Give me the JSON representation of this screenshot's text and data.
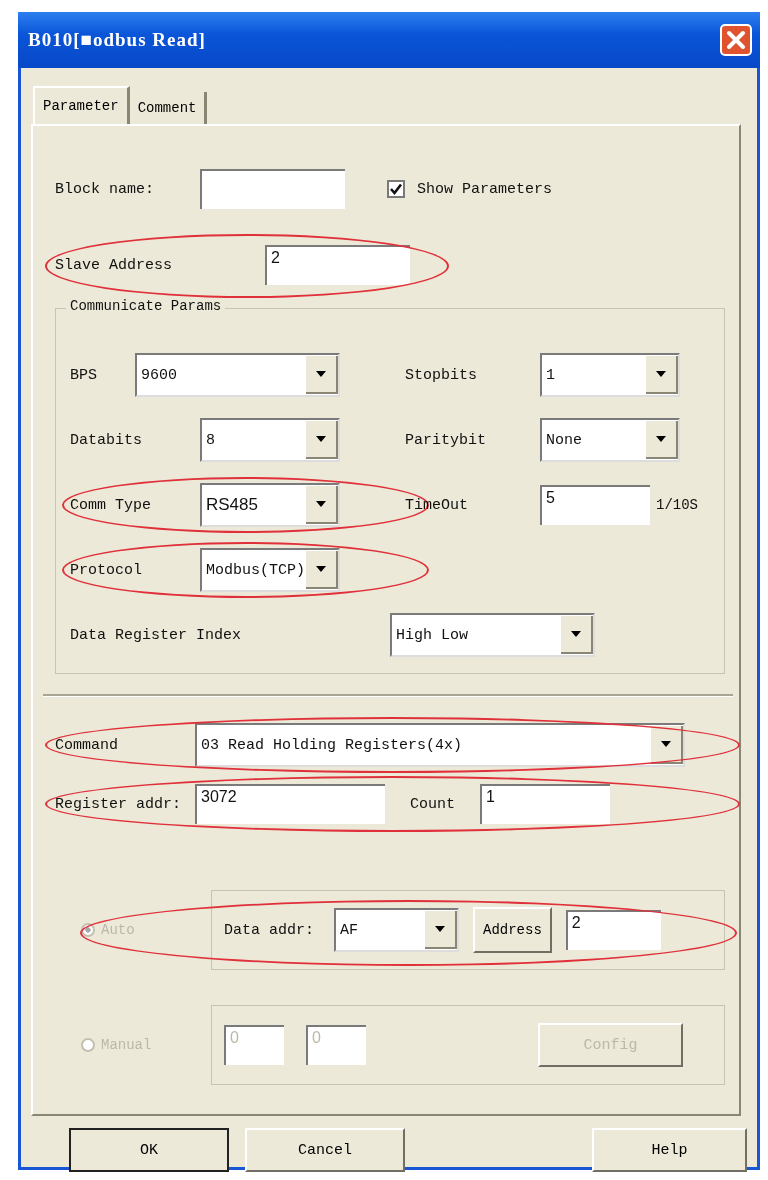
{
  "window": {
    "title": "B010[■odbus Read]"
  },
  "tabs": [
    {
      "label": "Parameter",
      "selected": true
    },
    {
      "label": "Comment",
      "selected": false
    }
  ],
  "block_name": {
    "label": "Block name:"
  },
  "show_parameters": {
    "label": "Show Parameters",
    "checked": true
  },
  "slave_address": {
    "label": "Slave Address",
    "value": "2",
    "highlighted": true
  },
  "communicate_params": {
    "title": "Communicate Params",
    "rows": [
      [
        {
          "kind": "dropdown",
          "label": "BPS",
          "value": "9600",
          "highlighted": false
        },
        {
          "kind": "dropdown",
          "label": "Stopbits",
          "value": "1",
          "highlighted": false
        }
      ],
      [
        {
          "kind": "dropdown",
          "label": "Databits",
          "value": "8",
          "highlighted": false
        },
        {
          "kind": "dropdown",
          "label": "Paritybit",
          "value": "None",
          "highlighted": false
        }
      ],
      [
        {
          "kind": "dropdown",
          "label": "Comm Type",
          "value": "RS485",
          "highlighted": true
        },
        {
          "kind": "text",
          "label": "TimeOut",
          "value": "5",
          "unit": "1/10S",
          "highlighted": false
        }
      ],
      [
        {
          "kind": "dropdown",
          "label": "Protocol",
          "value": "Modbus(TCP)",
          "highlighted": true
        }
      ],
      [
        {
          "kind": "dropdown",
          "label": "Data Register Index",
          "value": "High Low",
          "highlighted": false
        }
      ]
    ]
  },
  "command": {
    "label": "Command",
    "value": "03 Read Holding Registers(4x)",
    "highlighted": true
  },
  "register": {
    "address_label": "Register addr:",
    "address_value": "3072",
    "count_label": "Count",
    "count_value": "1",
    "highlighted": true
  },
  "auto": {
    "label": "Auto",
    "selected": true,
    "disabled": true,
    "highlighted": true,
    "data_addr_label": "Data addr:",
    "data_addr_value": "AF",
    "address_button": "Address",
    "address_value": "2"
  },
  "manual": {
    "label": "Manual",
    "selected": false,
    "disabled": true,
    "values": [
      "0",
      "0"
    ],
    "config_button": "Config"
  },
  "buttons": [
    {
      "label": "OK",
      "default": true
    },
    {
      "label": "Cancel",
      "default": false
    },
    {
      "label": "Help",
      "default": false
    }
  ]
}
